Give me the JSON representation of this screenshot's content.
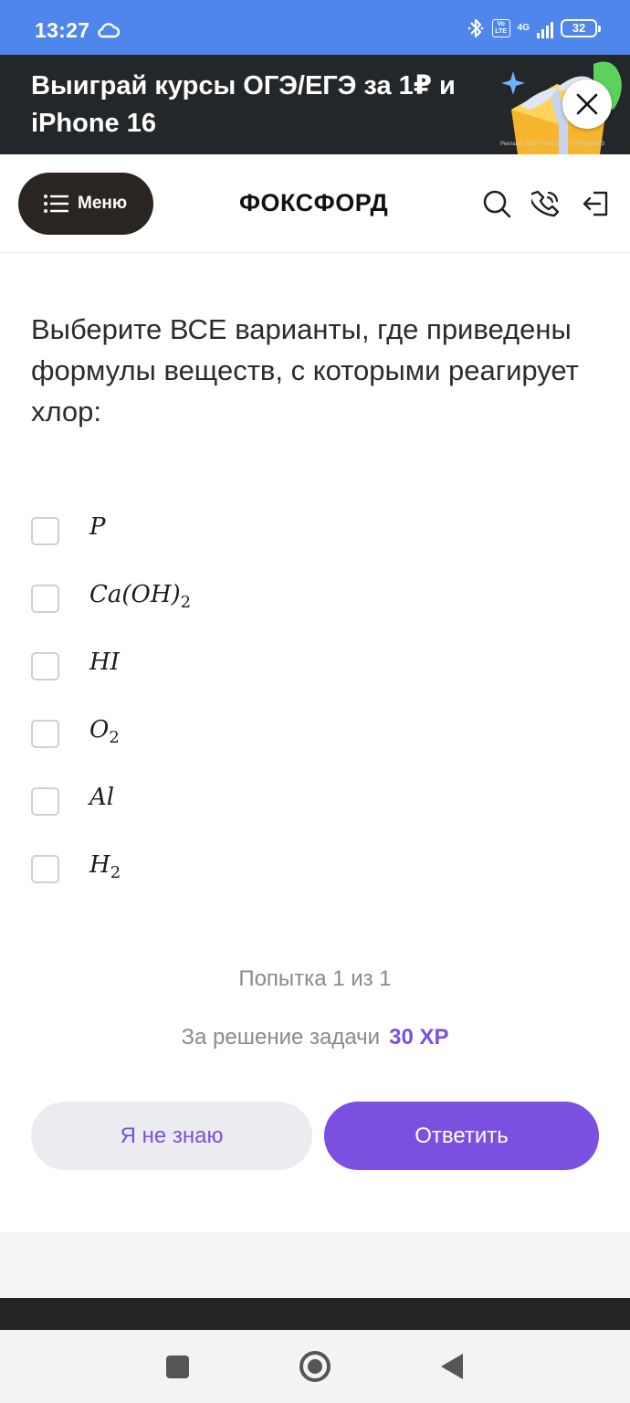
{
  "status_bar": {
    "time": "13:27",
    "volte_label": "Vo LTE",
    "network_label": "4G",
    "battery_level": "32"
  },
  "promo_banner": {
    "title": "Выиграй курсы ОГЭ/ЕГЭ за 1₽ и iPhone 16",
    "ad_note": "Реклама. ООО «Фоксфорд» 2VSb5yfaib3"
  },
  "header": {
    "menu_label": "Меню",
    "logo_text": "ФОКСФОРД"
  },
  "question": {
    "text": "Выберите ВСЕ варианты, где приведены формулы веществ, с которыми реагирует хлор:"
  },
  "options": [
    {
      "base": "P",
      "sub": "",
      "checked": false
    },
    {
      "base": "Ca(OH)",
      "sub": "2",
      "checked": false
    },
    {
      "base": "HI",
      "sub": "",
      "checked": false
    },
    {
      "base": "O",
      "sub": "2",
      "checked": false
    },
    {
      "base": "Al",
      "sub": "",
      "checked": false
    },
    {
      "base": "H",
      "sub": "2",
      "checked": false
    }
  ],
  "attempt_text": "Попытка 1 из 1",
  "reward": {
    "label": "За решение задачи",
    "xp": "30 XP"
  },
  "buttons": {
    "dont_know": "Я не знаю",
    "answer": "Ответить"
  },
  "colors": {
    "accent": "#7b4fe0",
    "status_bar": "#4f86ec",
    "banner_bg": "#24272a",
    "menu_button": "#2a2521"
  }
}
